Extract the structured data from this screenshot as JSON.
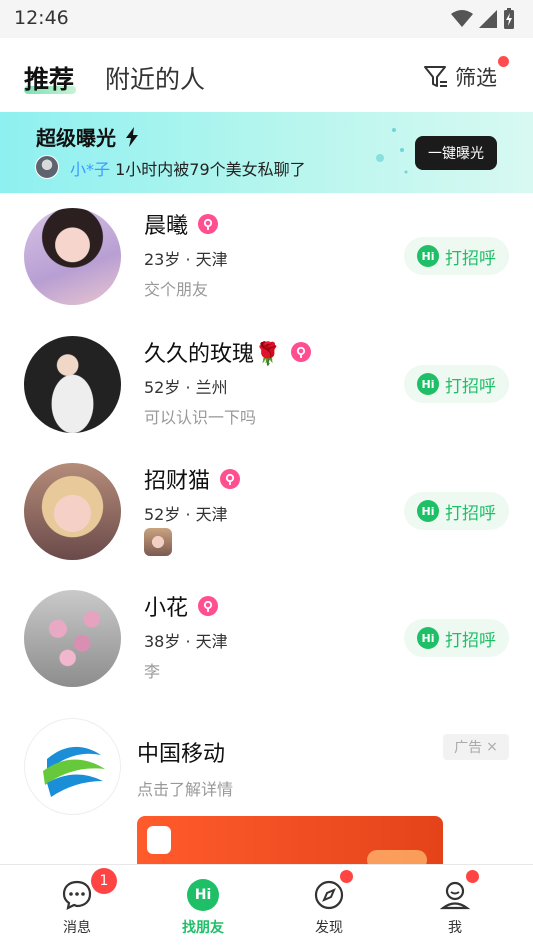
{
  "status_bar": {
    "time": "12:46"
  },
  "header": {
    "tab_active": "推荐",
    "tab_inactive": "附近的人",
    "filter_label": "筛选"
  },
  "banner": {
    "title": "超级曝光",
    "name": "小*子",
    "text": "1小时内被79个美女私聊了",
    "button": "一键曝光"
  },
  "users": [
    {
      "name": "晨曦",
      "meta": "23岁 · 天津",
      "sub": "交个朋友",
      "action": "打招呼"
    },
    {
      "name": "久久的玫瑰🌹",
      "meta": "52岁 · 兰州",
      "sub": "可以认识一下吗",
      "action": "打招呼"
    },
    {
      "name": "招财猫",
      "meta": "52岁 · 天津",
      "sub": "",
      "action": "打招呼"
    },
    {
      "name": "小花",
      "meta": "38岁 · 天津",
      "sub": "李",
      "action": "打招呼"
    }
  ],
  "ad": {
    "title": "中国移动",
    "sub": "点击了解详情",
    "tag": "广告",
    "tag_close": "×"
  },
  "tabbar": {
    "items": [
      {
        "label": "消息",
        "icon": "chat-bubble-icon"
      },
      {
        "label": "找朋友",
        "icon": "hi-icon"
      },
      {
        "label": "发现",
        "icon": "compass-icon"
      },
      {
        "label": "我",
        "icon": "profile-icon"
      }
    ],
    "messages_badge": "1"
  },
  "colors": {
    "accent_green": "#1fbf68",
    "badge_red": "#ff4444",
    "female_pink": "#ff4f91"
  }
}
